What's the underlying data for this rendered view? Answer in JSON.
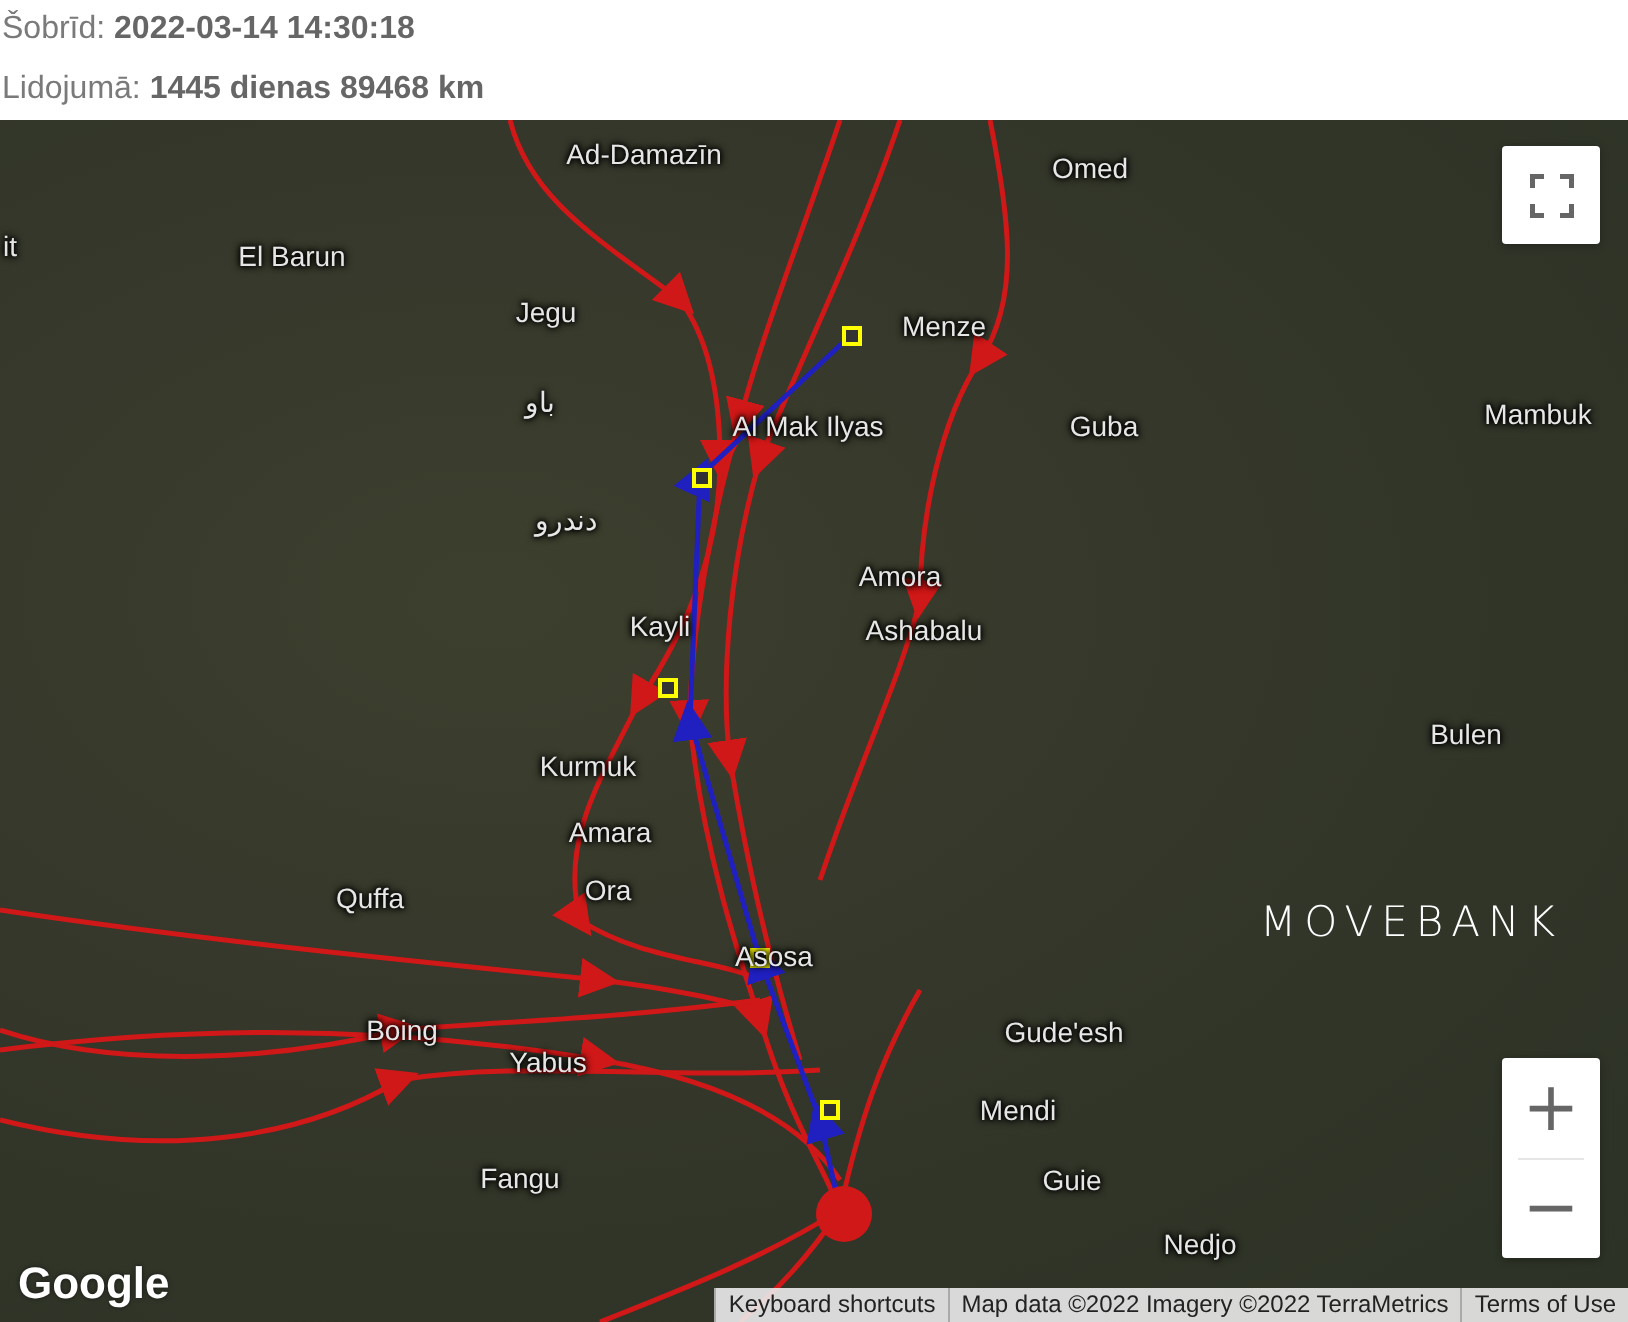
{
  "status_lines": [
    "Šobrīd: **2022-03-14 14:30:18**",
    "Lidojumā: **1445 dienas 89468 km**"
  ],
  "map": {
    "places": [
      {
        "name": "Ad-Damazīn"
      },
      {
        "name": "Omed"
      },
      {
        "name": "it"
      },
      {
        "name": "El Barun"
      },
      {
        "name": "Jegu"
      },
      {
        "name": "Menze"
      },
      {
        "name": "باو"
      },
      {
        "name": "Al Mak Ilyas"
      },
      {
        "name": "Guba"
      },
      {
        "name": "Mambuk"
      },
      {
        "name": "دندرو"
      },
      {
        "name": "Amora"
      },
      {
        "name": "Kayli"
      },
      {
        "name": "Ashabalu"
      },
      {
        "name": "Bulen"
      },
      {
        "name": "Kurmuk"
      },
      {
        "name": "Amara"
      },
      {
        "name": "Ora"
      },
      {
        "name": "Quffa"
      },
      {
        "name": "Asosa"
      },
      {
        "name": "Boing"
      },
      {
        "name": "Yabus"
      },
      {
        "name": "Gude'esh"
      },
      {
        "name": "Mendi"
      },
      {
        "name": "Guie"
      },
      {
        "name": "Fangu"
      },
      {
        "name": "Nedjo"
      }
    ],
    "logo": "MOVEBANK",
    "google_logo": "Google",
    "zoom_controls": [
      "+",
      "−"
    ],
    "attribution": [
      "Keyboard shortcuts",
      "Map data ©2022 Imagery ©2022 TerraMetrics",
      "Terms of Use"
    ]
  }
}
